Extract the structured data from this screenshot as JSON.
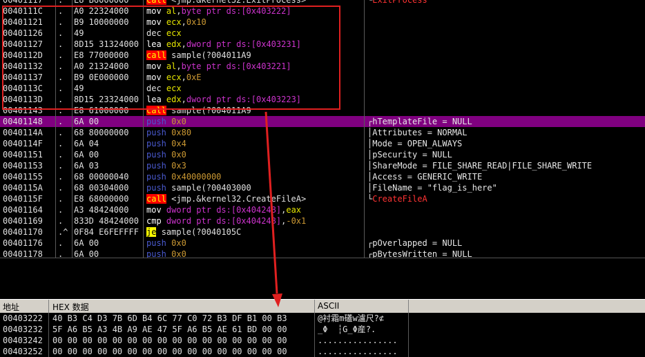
{
  "disasm": {
    "rows": [
      {
        "addr": "00401117",
        "mark": ".",
        "hex": "E8 B6000000",
        "mn": "call",
        "ops": "<jmp.&kernel32.ExitProcess>",
        "type": "call",
        "comment": "ExitProcess",
        "ctype": "api",
        "partial": true
      },
      {
        "addr": "0040111C",
        "mark": ".",
        "hex": "A0 22324000",
        "mn": "mov",
        "ops": "al,byte ptr ds:[0x403222]",
        "type": "mov"
      },
      {
        "addr": "00401121",
        "mark": ".",
        "hex": "B9 10000000",
        "mn": "mov",
        "ops": "ecx,0x10",
        "type": "mov"
      },
      {
        "addr": "00401126",
        "mark": ".",
        "hex": "49",
        "mn": "dec",
        "ops": "ecx",
        "type": "dec"
      },
      {
        "addr": "00401127",
        "mark": ".",
        "hex": "8D15 31324000",
        "mn": "lea",
        "ops": "edx,dword ptr ds:[0x403231]",
        "type": "mov"
      },
      {
        "addr": "0040112D",
        "mark": ".",
        "hex": "E8 77000000",
        "mn": "call",
        "ops": "sample(?004011A9",
        "type": "call"
      },
      {
        "addr": "00401132",
        "mark": ".",
        "hex": "A0 21324000",
        "mn": "mov",
        "ops": "al,byte ptr ds:[0x403221]",
        "type": "mov"
      },
      {
        "addr": "00401137",
        "mark": ".",
        "hex": "B9 0E000000",
        "mn": "mov",
        "ops": "ecx,0xE",
        "type": "mov"
      },
      {
        "addr": "0040113C",
        "mark": ".",
        "hex": "49",
        "mn": "dec",
        "ops": "ecx",
        "type": "dec"
      },
      {
        "addr": "0040113D",
        "mark": ".",
        "hex": "8D15 23324000",
        "mn": "lea",
        "ops": "edx,dword ptr ds:[0x403223]",
        "type": "mov"
      },
      {
        "addr": "00401143",
        "mark": ".",
        "hex": "E8 61000000",
        "mn": "call",
        "ops": "sample(?004011A9",
        "type": "call"
      },
      {
        "addr": "00401148",
        "mark": ".",
        "hex": "6A 00",
        "mn": "push",
        "ops": "0x0",
        "type": "push",
        "comment": "hTemplateFile = NULL",
        "ctype": "first",
        "selected": true
      },
      {
        "addr": "0040114A",
        "mark": ".",
        "hex": "68 80000000",
        "mn": "push",
        "ops": "0x80",
        "type": "push",
        "comment": "Attributes = NORMAL",
        "ctype": "mid"
      },
      {
        "addr": "0040114F",
        "mark": ".",
        "hex": "6A 04",
        "mn": "push",
        "ops": "0x4",
        "type": "push",
        "comment": "Mode = OPEN_ALWAYS",
        "ctype": "mid"
      },
      {
        "addr": "00401151",
        "mark": ".",
        "hex": "6A 00",
        "mn": "push",
        "ops": "0x0",
        "type": "push",
        "comment": "pSecurity = NULL",
        "ctype": "mid"
      },
      {
        "addr": "00401153",
        "mark": ".",
        "hex": "6A 03",
        "mn": "push",
        "ops": "0x3",
        "type": "push",
        "comment": "ShareMode = FILE_SHARE_READ|FILE_SHARE_WRITE",
        "ctype": "mid"
      },
      {
        "addr": "00401155",
        "mark": ".",
        "hex": "68 00000040",
        "mn": "push",
        "ops": "0x40000000",
        "type": "push",
        "comment": "Access = GENERIC_WRITE",
        "ctype": "mid"
      },
      {
        "addr": "0040115A",
        "mark": ".",
        "hex": "68 00304000",
        "mn": "push",
        "ops": "sample(?00403000",
        "type": "push",
        "comment": "FileName = \"flag_is_here\"",
        "ctype": "mid"
      },
      {
        "addr": "0040115F",
        "mark": ".",
        "hex": "E8 68000000",
        "mn": "call",
        "ops": "<jmp.&kernel32.CreateFileA>",
        "type": "call",
        "comment": "CreateFileA",
        "ctype": "api"
      },
      {
        "addr": "00401164",
        "mark": ".",
        "hex": "A3 48424000",
        "mn": "mov",
        "ops": "dword ptr ds:[0x404248],eax",
        "type": "mov"
      },
      {
        "addr": "00401169",
        "mark": ".",
        "hex": "833D 48424000",
        "mn": "cmp",
        "ops": "dword ptr ds:[0x404248],-0x1",
        "type": "mov"
      },
      {
        "addr": "00401170",
        "mark": ".^",
        "hex": "0F84 E6FEFFFF",
        "mn": "je",
        "ops": "sample(?0040105C",
        "type": "jcc"
      },
      {
        "addr": "00401176",
        "mark": ".",
        "hex": "6A 00",
        "mn": "push",
        "ops": "0x0",
        "type": "push",
        "comment": "pOverlapped = NULL",
        "ctype": "first"
      },
      {
        "addr": "00401178",
        "mark": ".",
        "hex": "6A 00",
        "mn": "push",
        "ops": "0x0",
        "type": "push",
        "comment": "pBytesWritten = NULL",
        "ctype": "first",
        "partial": true
      }
    ]
  },
  "dump": {
    "headers": {
      "addr": "地址",
      "hex": "HEX 数据",
      "ascii": "ASCII"
    },
    "rows": [
      {
        "addr": "00403222",
        "hex": "40 B3 C4 D3 7B 6D B4 6C 77 C0 72 B3 DF B1 00 B3",
        "ascii": "@衬霜m礚w瀘尺?⊄"
      },
      {
        "addr": "00403232",
        "hex": "5F A6 B5 A3 4B A9 AE 47 5F A6 B5 AE 61 BD 00 00",
        "ascii": "_Φ  ┆G_Φ産?."
      },
      {
        "addr": "00403242",
        "hex": "00 00 00 00 00 00 00 00 00 00 00 00 00 00 00 00",
        "ascii": "................"
      },
      {
        "addr": "00403252",
        "hex": "00 00 00 00 00 00 00 00 00 00 00 00 00 00 00 00",
        "ascii": "................"
      }
    ]
  },
  "colors": {
    "selected_row": "#800080",
    "highlight_box": "#e02020",
    "call_bg": "#ff0000",
    "je_bg": "#ffff00"
  }
}
